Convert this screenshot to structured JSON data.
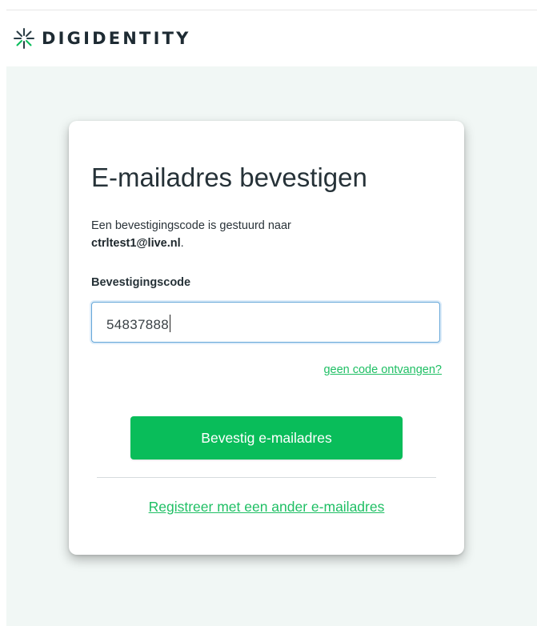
{
  "brand": {
    "name": "DIGIDENTITY",
    "accent_color": "#09bd5a",
    "logo_icon": "starburst-icon"
  },
  "card": {
    "title": "E-mailadres bevestigen",
    "description_prefix": "Een bevestigingscode is gestuurd naar",
    "email": "ctrltest1@live.nl",
    "email_suffix": ".",
    "field_label": "Bevestigingscode",
    "code_value": "54837888",
    "resend_link": "geen code ontvangen?",
    "confirm_button": "Bevestig e-mailadres",
    "alt_link": "Registreer met een ander e-mailadres"
  }
}
